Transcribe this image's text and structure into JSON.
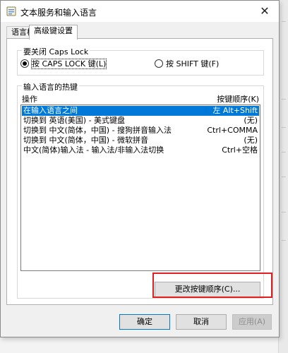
{
  "window": {
    "title": "文本服务和输入语言",
    "close_label": "✕"
  },
  "tabs": [
    {
      "label": "语言栏",
      "active": false
    },
    {
      "label": "高级键设置",
      "active": true
    }
  ],
  "caps_lock_group": {
    "title": "要关闭 Caps Lock",
    "options": [
      {
        "label": "按 CAPS LOCK 键(L)",
        "checked": true
      },
      {
        "label": "按 SHIFT 键(F)",
        "checked": false
      }
    ]
  },
  "hotkeys_group": {
    "title": "输入语言的热键",
    "column_action": "操作",
    "column_key": "按键顺序(K)",
    "rows": [
      {
        "action": "在输入语言之间",
        "key": "左 Alt+Shift",
        "selected": true
      },
      {
        "action": "切换到 英语(美国) - 美式键盘",
        "key": "(无)",
        "selected": false
      },
      {
        "action": "切换到 中文(简体，中国) - 搜狗拼音输入法",
        "key": "Ctrl+COMMA",
        "selected": false
      },
      {
        "action": "切换到 中文(简体，中国) - 微软拼音",
        "key": "(无)",
        "selected": false
      },
      {
        "action": "中文(简体)输入法 - 输入法/非输入法切换",
        "key": "Ctrl+空格",
        "selected": false
      }
    ],
    "change_button": "更改按键顺序(C)..."
  },
  "footer": {
    "ok": "确定",
    "cancel": "取消",
    "apply": "应用(A)"
  },
  "colors": {
    "selection": "#0078d7",
    "highlight_box": "#e02020"
  }
}
